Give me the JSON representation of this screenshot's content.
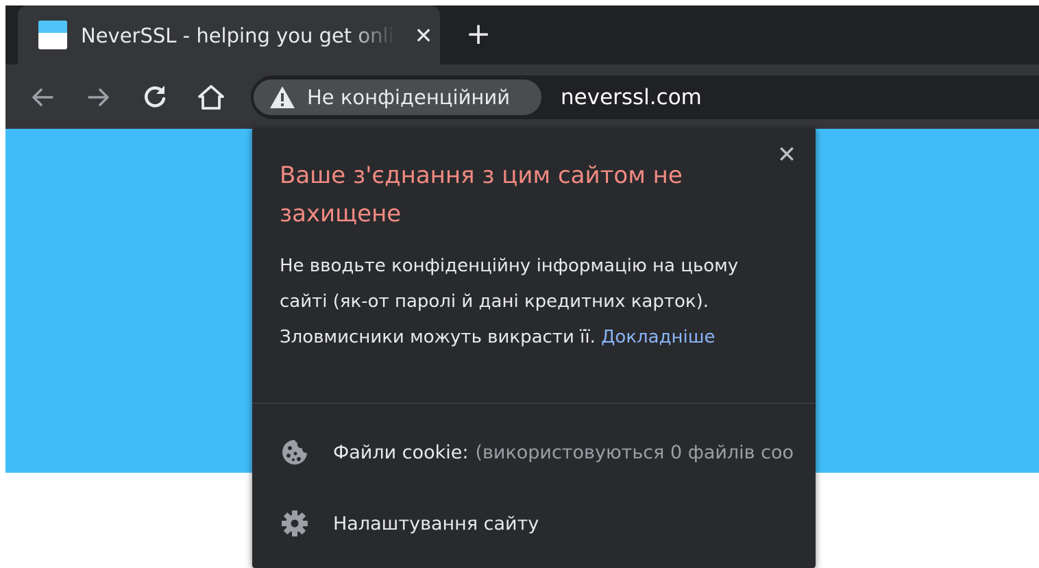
{
  "tab": {
    "title": "NeverSSL - helping you get online",
    "close_glyph": "✕",
    "favicon": "neverssl-favicon"
  },
  "new_tab_glyph": "+",
  "toolbar": {
    "back": "back-arrow-icon",
    "forward": "forward-arrow-icon",
    "reload": "reload-icon",
    "home": "home-icon"
  },
  "omnibox": {
    "security_label": "Не конфіденційний",
    "security_icon": "warning-triangle-icon",
    "url": "neverssl.com"
  },
  "page": {
    "band_color": "#40bdf8"
  },
  "popup": {
    "close_glyph": "✕",
    "title": "Ваше з'єднання з цим сайтом не захищене",
    "body": "Не вводьте конфіденційну інформацію на цьому сайті (як-от паролі й дані кредитних карток). Зловмисники можуть викрасти її.",
    "learn_more": "Докладніше",
    "cookies": {
      "icon": "cookie-icon",
      "label": "Файли cookie:",
      "detail": "(використовуються 0 файлів соо"
    },
    "site_settings": {
      "icon": "gear-icon",
      "label": "Налаштування сайту"
    }
  },
  "colors": {
    "title_red": "#f28b82",
    "link_blue": "#8ab4f8",
    "popup_bg": "#292a2d",
    "toolbar_bg": "#35363a",
    "tabstrip_bg": "#202124"
  }
}
